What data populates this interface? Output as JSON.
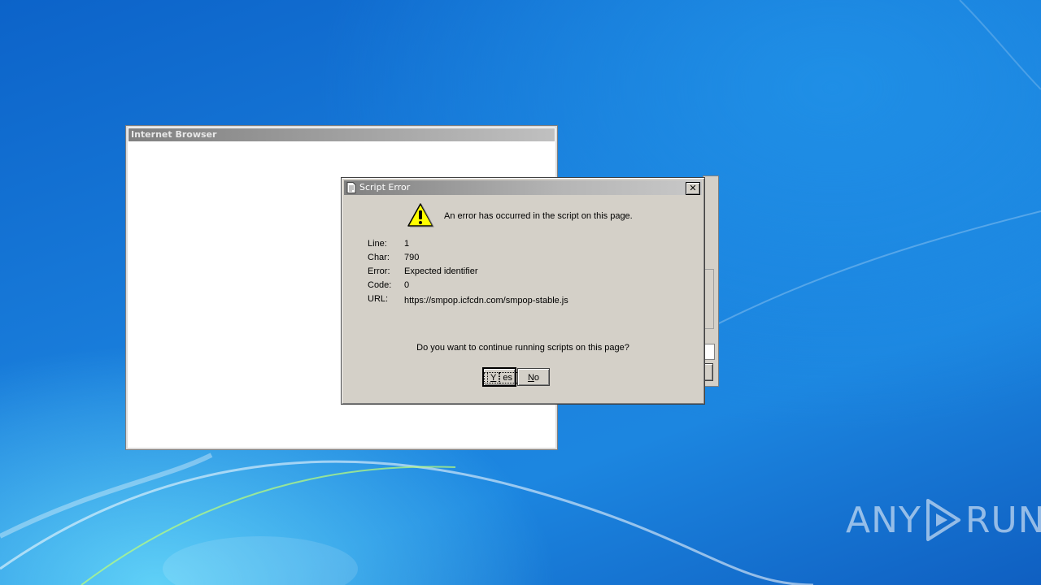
{
  "browser_window": {
    "title": "Internet Browser"
  },
  "dialog": {
    "title": "Script Error",
    "close_label": "✕",
    "message": "An error has occurred in the script on this page.",
    "details": [
      {
        "label": "Line:",
        "value": "1"
      },
      {
        "label": "Char:",
        "value": "790"
      },
      {
        "label": "Error:",
        "value": "Expected identifier"
      },
      {
        "label": "Code:",
        "value": "0"
      },
      {
        "label": "URL:",
        "value": "https://smpop.icfcdn.com/smpop-stable.js"
      }
    ],
    "question": "Do you want to continue running scripts on this page?",
    "yes_label_mnemonic": "Y",
    "yes_label_rest": "es",
    "no_label_mnemonic": "N",
    "no_label_rest": "o"
  },
  "watermark": {
    "left": "ANY",
    "right": "RUN"
  }
}
